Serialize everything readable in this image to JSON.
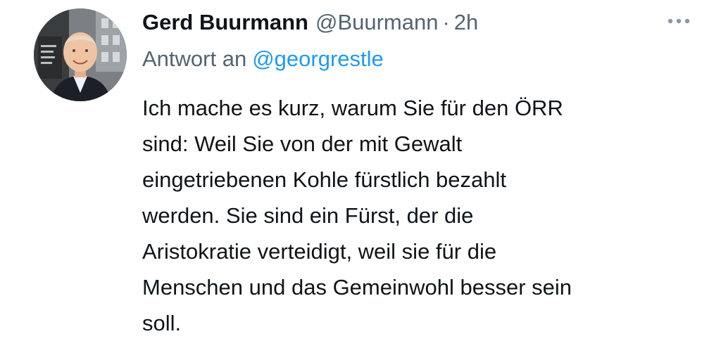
{
  "tweet": {
    "author": {
      "display_name": "Gerd Buurmann",
      "handle": "@Buurmann",
      "avatar_icon": "profile-photo"
    },
    "separator": "·",
    "timestamp": "2h",
    "more_icon": "ellipsis-icon",
    "reply_to": {
      "label": "Antwort an",
      "mention": "@georgrestle"
    },
    "body_lines": [
      "Ich mache es kurz, warum Sie für den ÖRR",
      "sind: Weil Sie von der mit Gewalt",
      "eingetriebenen Kohle fürstlich bezahlt",
      "werden. Sie sind ein Fürst, der die",
      "Aristokratie verteidigt, weil sie für die",
      "Menschen und das Gemeinwohl besser sein",
      "soll."
    ]
  },
  "colors": {
    "text_primary": "#0f1419",
    "text_secondary": "#536471",
    "link": "#1d9bf0",
    "background": "#ffffff"
  }
}
